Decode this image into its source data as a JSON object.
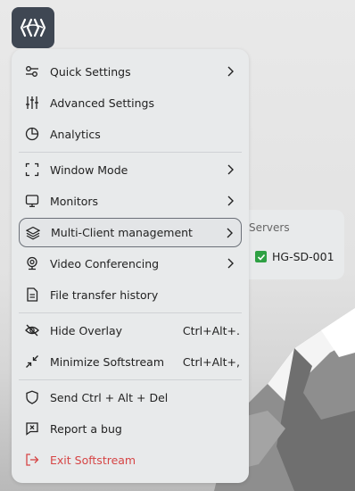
{
  "menu": {
    "items": [
      {
        "icon": "sliders-toggle-icon",
        "label": "Quick Settings",
        "shortcut": "",
        "submenu": true
      },
      {
        "icon": "equalizer-icon",
        "label": "Advanced Settings",
        "shortcut": "",
        "submenu": false
      },
      {
        "icon": "pie-chart-icon",
        "label": "Analytics",
        "shortcut": "",
        "submenu": false
      },
      {
        "icon": "fullscreen-corners-icon",
        "label": "Window Mode",
        "shortcut": "",
        "submenu": true
      },
      {
        "icon": "monitor-icon",
        "label": "Monitors",
        "shortcut": "",
        "submenu": true
      },
      {
        "icon": "layers-icon",
        "label": "Multi-Client management",
        "shortcut": "",
        "submenu": true
      },
      {
        "icon": "webcam-icon",
        "label": "Video Conferencing",
        "shortcut": "",
        "submenu": true
      },
      {
        "icon": "document-icon",
        "label": "File transfer history",
        "shortcut": "",
        "submenu": false
      },
      {
        "icon": "eye-off-icon",
        "label": "Hide Overlay",
        "shortcut": "Ctrl+Alt+.",
        "submenu": false
      },
      {
        "icon": "minimize-arrows-icon",
        "label": "Minimize Softstream",
        "shortcut": "Ctrl+Alt+,",
        "submenu": false
      },
      {
        "icon": "shield-icon",
        "label": "Send Ctrl + Alt + Del",
        "shortcut": "",
        "submenu": false
      },
      {
        "icon": "bug-report-icon",
        "label": "Report a bug",
        "shortcut": "",
        "submenu": false
      },
      {
        "icon": "exit-icon",
        "label": "Exit Softstream",
        "shortcut": "",
        "submenu": false
      }
    ]
  },
  "submenu": {
    "title": "Servers",
    "servers": [
      {
        "name": "HG-SD-001",
        "checked": true
      }
    ]
  },
  "colors": {
    "menu_bg": "#e8eaeb",
    "logo_bg": "#3f4753",
    "exit": "#d64545",
    "check": "#2ea043"
  }
}
